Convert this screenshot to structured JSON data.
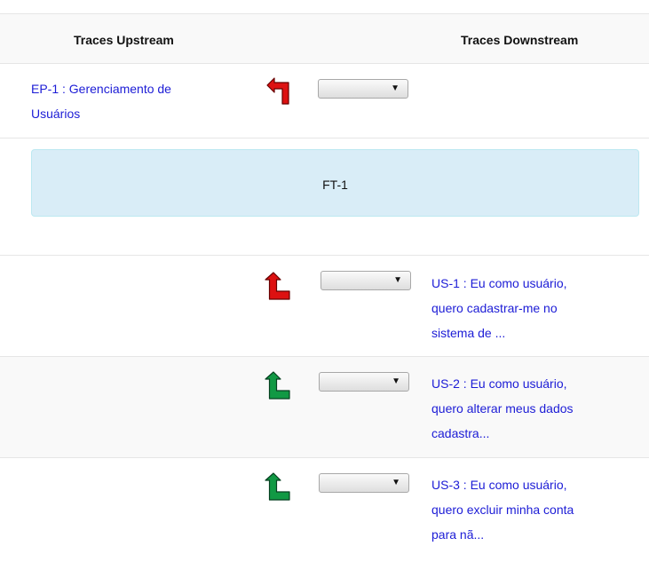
{
  "header": {
    "upstream_label": "Traces Upstream",
    "downstream_label": "Traces Downstream"
  },
  "upstream": {
    "line1": "EP-1 : Gerenciamento de",
    "line2": "Usuários",
    "arrow_color": "#dd1111"
  },
  "feature": {
    "label": "FT-1",
    "bg_color": "#d9edf7"
  },
  "downstream": [
    {
      "line1": "US-1 : Eu como usuário,",
      "line2": "quero cadastrar-me no",
      "line3": "sistema de ...",
      "arrow_color": "#dd1111"
    },
    {
      "line1": "US-2 : Eu como usuário,",
      "line2": "quero alterar meus dados",
      "line3": "cadastra...",
      "arrow_color": "#119944"
    },
    {
      "line1": "US-3 : Eu como usuário,",
      "line2": "quero excluir minha conta",
      "line3": "para nã...",
      "arrow_color": "#119944"
    }
  ],
  "link_color": "#1c1cd6"
}
